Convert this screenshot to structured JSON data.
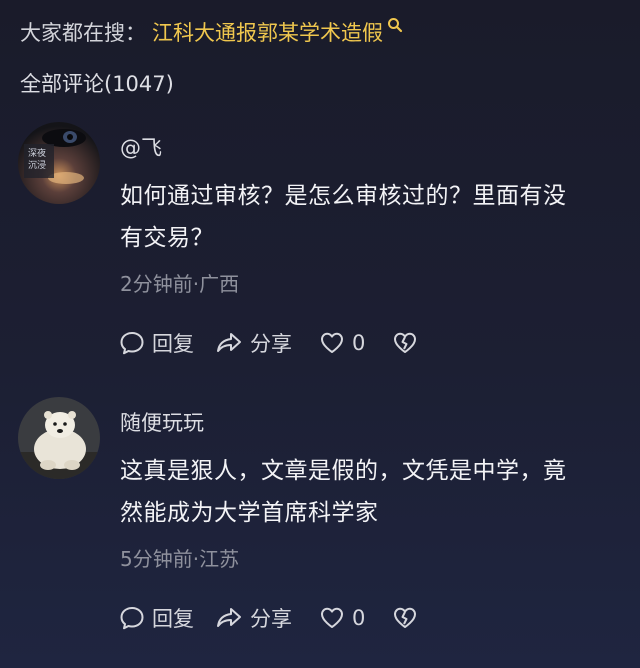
{
  "search": {
    "prefix": "大家都在搜：",
    "link": "江科大通报郭某学术造假"
  },
  "comments_header": {
    "label": "全部评论(1047)"
  },
  "comments": [
    {
      "username": "@飞",
      "text_line1": "如何通过审核？是怎么审核过的？里面有没",
      "text_line2": "有交易？",
      "meta": "2分钟前·广西",
      "reply_label": "回复",
      "share_label": "分享",
      "like_count": "0"
    },
    {
      "username": "随便玩玩",
      "text_line1": "这真是狠人，文章是假的，文凭是中学，竟",
      "text_line2": "然能成为大学首席科学家",
      "meta": "5分钟前·江苏",
      "reply_label": "回复",
      "share_label": "分享",
      "like_count": "0"
    }
  ],
  "colors": {
    "accent": "#f0c74e",
    "background": "#1c1f33",
    "meta": "#8f919d"
  }
}
